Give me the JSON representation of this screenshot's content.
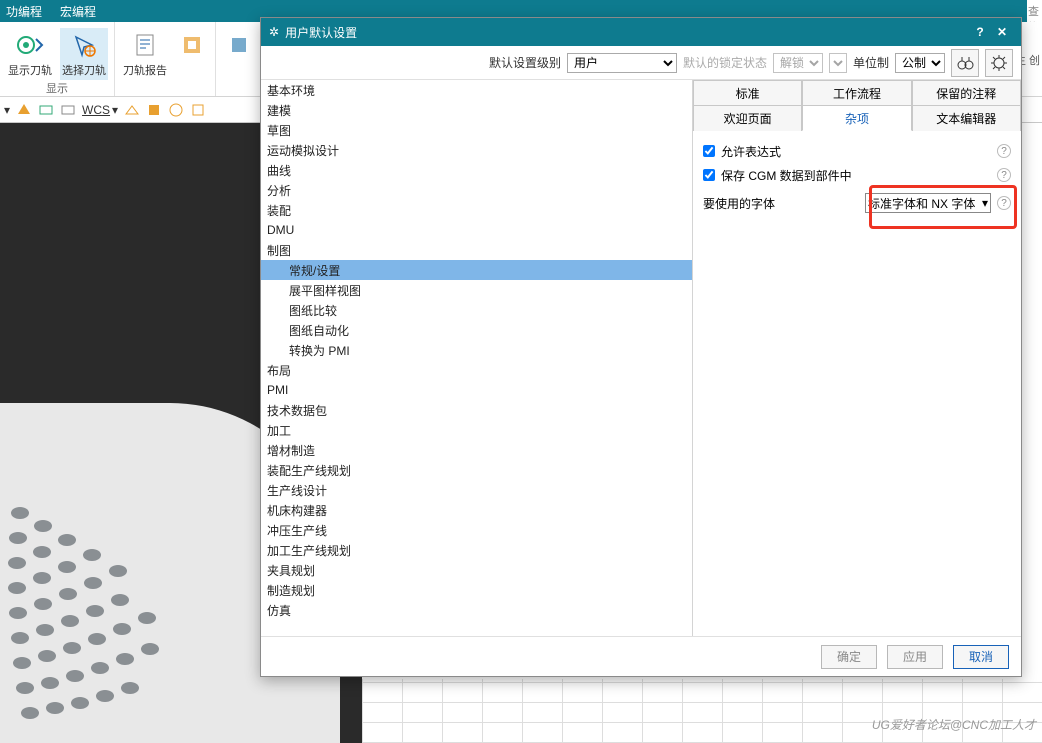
{
  "menubar": {
    "items": [
      "功编程",
      "宏编程"
    ]
  },
  "search_placeholder": "查找",
  "ribbon": {
    "group1": {
      "btn1": "显示刀轨",
      "btn2": "选择刀轨",
      "label": "显示"
    },
    "group2": {
      "btn1": "刀轨报告"
    },
    "right_label": "主 创"
  },
  "toolbar2": {
    "wcs": "WCS"
  },
  "dialog": {
    "title": "用户默认设置",
    "row": {
      "level_label": "默认设置级别",
      "level_value": "用户",
      "lock_label": "默认的锁定状态",
      "lock_value": "解锁",
      "unit_label": "单位制",
      "unit_value": "公制"
    },
    "tree": [
      {
        "l": 0,
        "t": "基本环境"
      },
      {
        "l": 0,
        "t": "建模"
      },
      {
        "l": 0,
        "t": "草图"
      },
      {
        "l": 0,
        "t": "运动模拟设计"
      },
      {
        "l": 0,
        "t": "曲线"
      },
      {
        "l": 0,
        "t": "分析"
      },
      {
        "l": 0,
        "t": "装配"
      },
      {
        "l": 0,
        "t": "DMU"
      },
      {
        "l": 0,
        "t": "制图"
      },
      {
        "l": 1,
        "t": "常规/设置",
        "sel": true
      },
      {
        "l": 1,
        "t": "展平图样视图"
      },
      {
        "l": 1,
        "t": "图纸比较"
      },
      {
        "l": 1,
        "t": "图纸自动化"
      },
      {
        "l": 1,
        "t": "转换为 PMI"
      },
      {
        "l": 0,
        "t": "布局"
      },
      {
        "l": 0,
        "t": "PMI"
      },
      {
        "l": 0,
        "t": "技术数据包"
      },
      {
        "l": 0,
        "t": "加工"
      },
      {
        "l": 0,
        "t": "增材制造"
      },
      {
        "l": 0,
        "t": "装配生产线规划"
      },
      {
        "l": 0,
        "t": "生产线设计"
      },
      {
        "l": 0,
        "t": "机床构建器"
      },
      {
        "l": 0,
        "t": "冲压生产线"
      },
      {
        "l": 0,
        "t": "加工生产线规划"
      },
      {
        "l": 0,
        "t": "夹具规划"
      },
      {
        "l": 0,
        "t": "制造规划"
      },
      {
        "l": 0,
        "t": "仿真"
      }
    ],
    "tabs": [
      "标准",
      "工作流程",
      "保留的注释",
      "欢迎页面",
      "杂项",
      "文本编辑器"
    ],
    "active_tab": 4,
    "opts": {
      "allow_expr": "允许表达式",
      "save_cgm": "保存 CGM 数据到部件中",
      "font_label": "要使用的字体",
      "font_value": "标准字体和 NX 字体"
    },
    "buttons": {
      "ok": "确定",
      "apply": "应用",
      "cancel": "取消"
    }
  },
  "watermark": "UG爱好者论坛@CNC加工人才"
}
